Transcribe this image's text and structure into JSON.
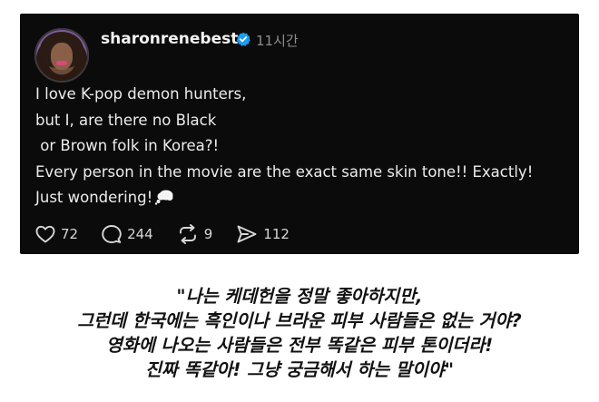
{
  "post": {
    "username": "sharonrenebest",
    "time": "11시간",
    "lines": [
      "I love K-pop demon hunters,",
      "but I, are there no Black",
      " or Brown folk in Korea?!",
      "Every person in the movie are the exact same skin tone!! Exactly!",
      "Just wondering!"
    ],
    "counts": {
      "likes": "72",
      "comments": "244",
      "reposts": "9",
      "shares": "112"
    }
  },
  "caption": {
    "lines": [
      "\"나는 케데헌을 정말 좋아하지만,",
      "그런데 한국에는 흑인이나 브라운 피부 사람들은 없는 거야?",
      "영화에 나오는 사람들은 전부 똑같은 피부 톤이더라!",
      "진짜 똑같아! 그냥 궁금해서 하는 말이야\""
    ]
  },
  "icons": {
    "verified": "verified-badge-icon",
    "bubble": "thought-bubble-icon",
    "like": "heart-icon",
    "comment": "comment-icon",
    "repost": "repost-icon",
    "share": "share-icon"
  },
  "colors": {
    "post_bg": "#0b0b0b",
    "verified": "#1d9bf0",
    "text": "#ececec",
    "muted": "#8d8d8d"
  }
}
